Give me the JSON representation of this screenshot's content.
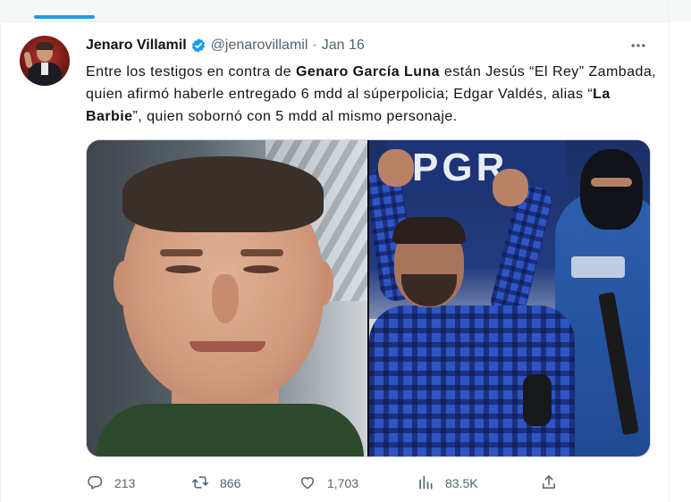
{
  "tweet": {
    "author_name": "Jenaro Villamil",
    "handle": "@jenarovillamil",
    "separator": "·",
    "date": "Jan 16",
    "text": {
      "t1": "Entre los testigos en contra de ",
      "b1": "Genaro García Luna",
      "t2": " están Jesús “El Rey” Zambada, quien afirmó haberle entregado 6 mdd al súperpolicia; Edgar Valdés, alias “",
      "b2": "La Barbie",
      "t3": "”, quien sobornó con 5 mdd al mismo personaje."
    },
    "media": {
      "sign_text": "PGR"
    },
    "metrics": {
      "replies": "213",
      "retweets": "866",
      "likes": "1,703",
      "views": "83.5K"
    }
  },
  "icons": {
    "verified": "verified-badge-icon",
    "more": "more-options-icon",
    "reply": "reply-icon",
    "retweet": "retweet-icon",
    "like": "heart-icon",
    "views": "views-chart-icon",
    "share": "share-icon"
  },
  "colors": {
    "accent": "#1d9bf0",
    "text_primary": "#0f1419",
    "text_secondary": "#536471",
    "border": "#cfd9de"
  }
}
